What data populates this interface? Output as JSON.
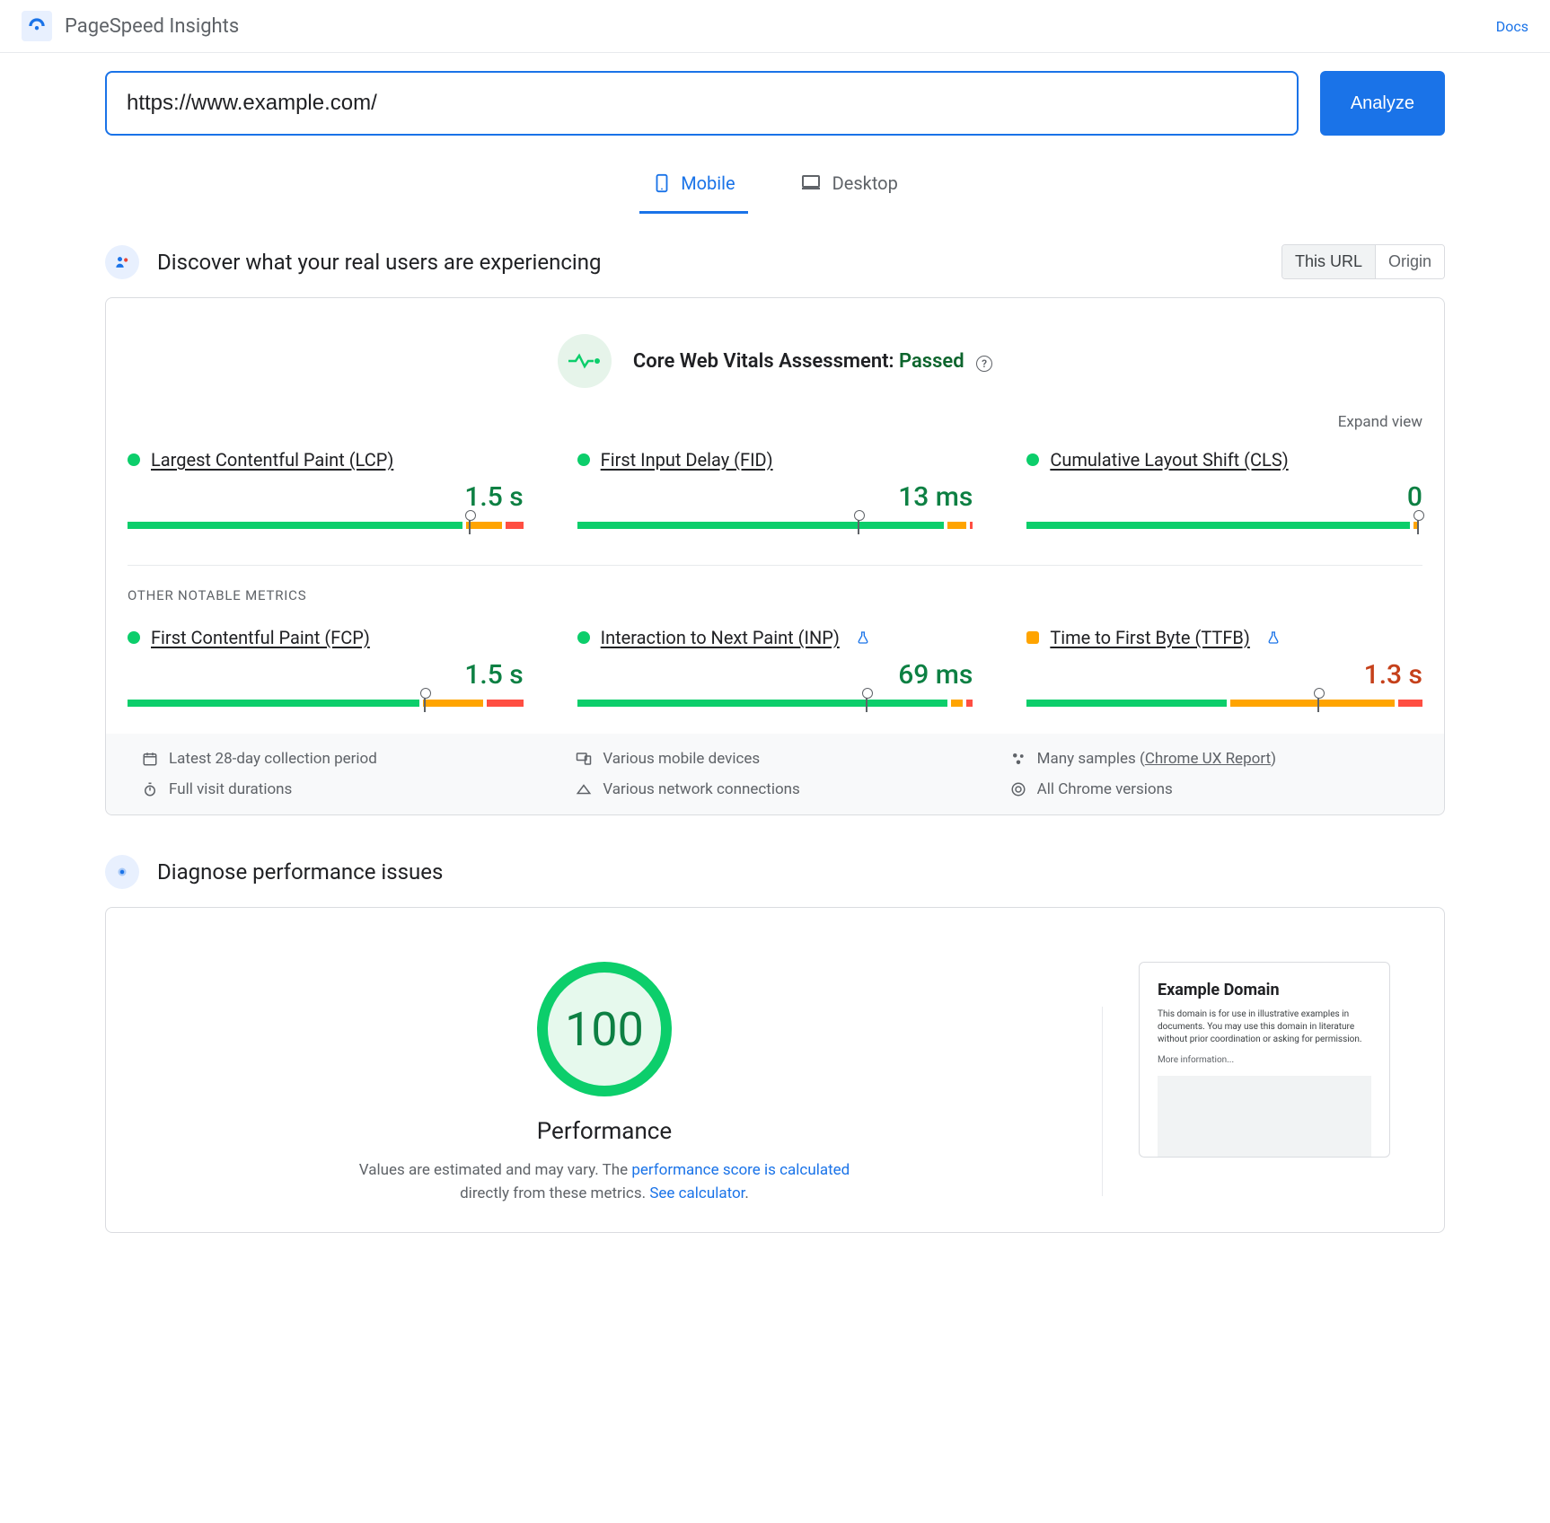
{
  "header": {
    "app_title": "PageSpeed Insights",
    "docs_label": "Docs"
  },
  "url_bar": {
    "value": "https://www.example.com/",
    "analyze_label": "Analyze"
  },
  "tabs": {
    "mobile": "Mobile",
    "desktop": "Desktop",
    "active": "mobile"
  },
  "field_data": {
    "section_title": "Discover what your real users are experiencing",
    "toggle": {
      "this_url": "This URL",
      "origin": "Origin"
    },
    "cwv_label": "Core Web Vitals Assessment: ",
    "cwv_status": "Passed",
    "expand_label": "Expand view",
    "metrics": [
      {
        "name": "Largest Contentful Paint (LCP)",
        "value": "1.5 s",
        "status": "green",
        "segments": [
          56,
          6,
          3
        ],
        "marker_pct": 56,
        "flask": false
      },
      {
        "name": "First Input Delay (FID)",
        "value": "13 ms",
        "status": "green",
        "segments": [
          60,
          3,
          0.5
        ],
        "marker_pct": 45,
        "flask": false
      },
      {
        "name": "Cumulative Layout Shift (CLS)",
        "value": "0",
        "status": "green",
        "segments": [
          75,
          1,
          0
        ],
        "marker_pct": 75,
        "flask": false
      }
    ],
    "other_label": "OTHER NOTABLE METRICS",
    "other_metrics": [
      {
        "name": "First Contentful Paint (FCP)",
        "value": "1.5 s",
        "status": "green",
        "value_class": "green",
        "segments": [
          48,
          10,
          6
        ],
        "marker_pct": 48,
        "flask": false
      },
      {
        "name": "Interaction to Next Paint (INP)",
        "value": "69 ms",
        "status": "green",
        "value_class": "green",
        "segments": [
          60,
          2,
          1
        ],
        "marker_pct": 46,
        "flask": true
      },
      {
        "name": "Time to First Byte (TTFB)",
        "value": "1.3 s",
        "status": "orange",
        "value_class": "orange",
        "segments": [
          33,
          27,
          4
        ],
        "marker_pct": 47,
        "flask": true
      }
    ],
    "footer": {
      "period": "Latest 28-day collection period",
      "devices": "Various mobile devices",
      "samples_prefix": "Many samples (",
      "samples_link": "Chrome UX Report",
      "samples_suffix": ")",
      "durations": "Full visit durations",
      "networks": "Various network connections",
      "versions": "All Chrome versions"
    }
  },
  "diagnose": {
    "section_title": "Diagnose performance issues",
    "score": "100",
    "score_label": "Performance",
    "desc_prefix": "Values are estimated and may vary. The ",
    "desc_link1": "performance score is calculated",
    "desc_mid": " directly from these metrics. ",
    "desc_link2": "See calculator",
    "desc_suffix": ".",
    "preview": {
      "title": "Example Domain",
      "text": "This domain is for use in illustrative examples in documents. You may use this domain in literature without prior coordination or asking for permission.",
      "more": "More information..."
    }
  }
}
